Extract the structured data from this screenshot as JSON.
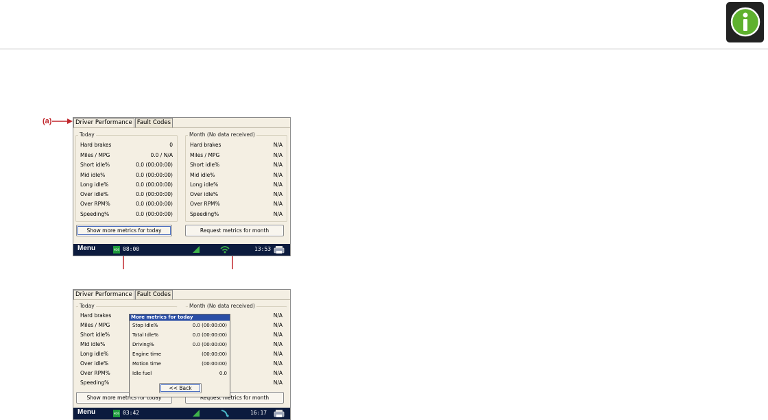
{
  "annotation_label": "(a)",
  "colors": {
    "accent_red": "#c0272d",
    "taskbar": "#0c1b3e",
    "dialog_title": "#2a4ea6",
    "hos_green": "#1e9b3c"
  },
  "icons": {
    "info": "info-icon",
    "signal": "signal-icon",
    "wifi": "wifi-icon",
    "printer": "printer-icon"
  },
  "screen1": {
    "tabs": [
      "Driver Performance",
      "Fault Codes"
    ],
    "today": {
      "title": "Today",
      "rows": [
        {
          "label": "Hard brakes",
          "value": "0"
        },
        {
          "label": "Miles / MPG",
          "value": "0.0 / N/A"
        },
        {
          "label": "Short idle%",
          "value": "0.0 (00:00:00)"
        },
        {
          "label": "Mid idle%",
          "value": "0.0 (00:00:00)"
        },
        {
          "label": "Long idle%",
          "value": "0.0 (00:00:00)"
        },
        {
          "label": "Over idle%",
          "value": "0.0 (00:00:00)"
        },
        {
          "label": "Over RPM%",
          "value": "0.0 (00:00:00)"
        },
        {
          "label": "Speeding%",
          "value": "0.0 (00:00:00)"
        }
      ]
    },
    "month": {
      "title": "Month    (No data received)",
      "rows": [
        {
          "label": "Hard brakes",
          "value": "N/A"
        },
        {
          "label": "Miles / MPG",
          "value": "N/A"
        },
        {
          "label": "Short idle%",
          "value": "N/A"
        },
        {
          "label": "Mid idle%",
          "value": "N/A"
        },
        {
          "label": "Long idle%",
          "value": "N/A"
        },
        {
          "label": "Over idle%",
          "value": "N/A"
        },
        {
          "label": "Over RPM%",
          "value": "N/A"
        },
        {
          "label": "Speeding%",
          "value": "N/A"
        }
      ]
    },
    "buttons": {
      "today": "Show more metrics for today",
      "month": "Request metrics for month"
    },
    "taskbar": {
      "menu": "Menu",
      "hos": "HOS",
      "hos_time": "08:00",
      "clock": "13:53"
    }
  },
  "screen2": {
    "tabs": [
      "Driver Performance",
      "Fault Codes"
    ],
    "today_title": "Today",
    "month_title": "Month    (No data received)",
    "left_labels": [
      "Hard brakes",
      "Miles / MPG",
      "Short idle%",
      "Mid idle%",
      "Long idle%",
      "Over idle%",
      "Over RPM%",
      "Speeding%"
    ],
    "right_values": [
      "N/A",
      "N/A",
      "N/A",
      "N/A",
      "N/A",
      "N/A",
      "N/A",
      "N/A"
    ],
    "dialog": {
      "title": "More metrics for today",
      "rows": [
        {
          "label": "Stop Idle%",
          "value": "0.0 (00:00:00)"
        },
        {
          "label": "Total Idle%",
          "value": "0.0 (00:00:00)"
        },
        {
          "label": "Driving%",
          "value": "0.0 (00:00:00)"
        },
        {
          "label": "Engine time",
          "value": "(00:00:00)"
        },
        {
          "label": "Motion time",
          "value": "(00:00:00)"
        },
        {
          "label": "Idle fuel",
          "value": "0.0"
        }
      ],
      "back": "<< Back"
    },
    "buttons": {
      "today": "Show more metrics for today",
      "month": "Request metrics for month"
    },
    "taskbar": {
      "menu": "Menu",
      "hos": "HOS",
      "hos_time": "03:42",
      "clock": "16:17"
    }
  }
}
